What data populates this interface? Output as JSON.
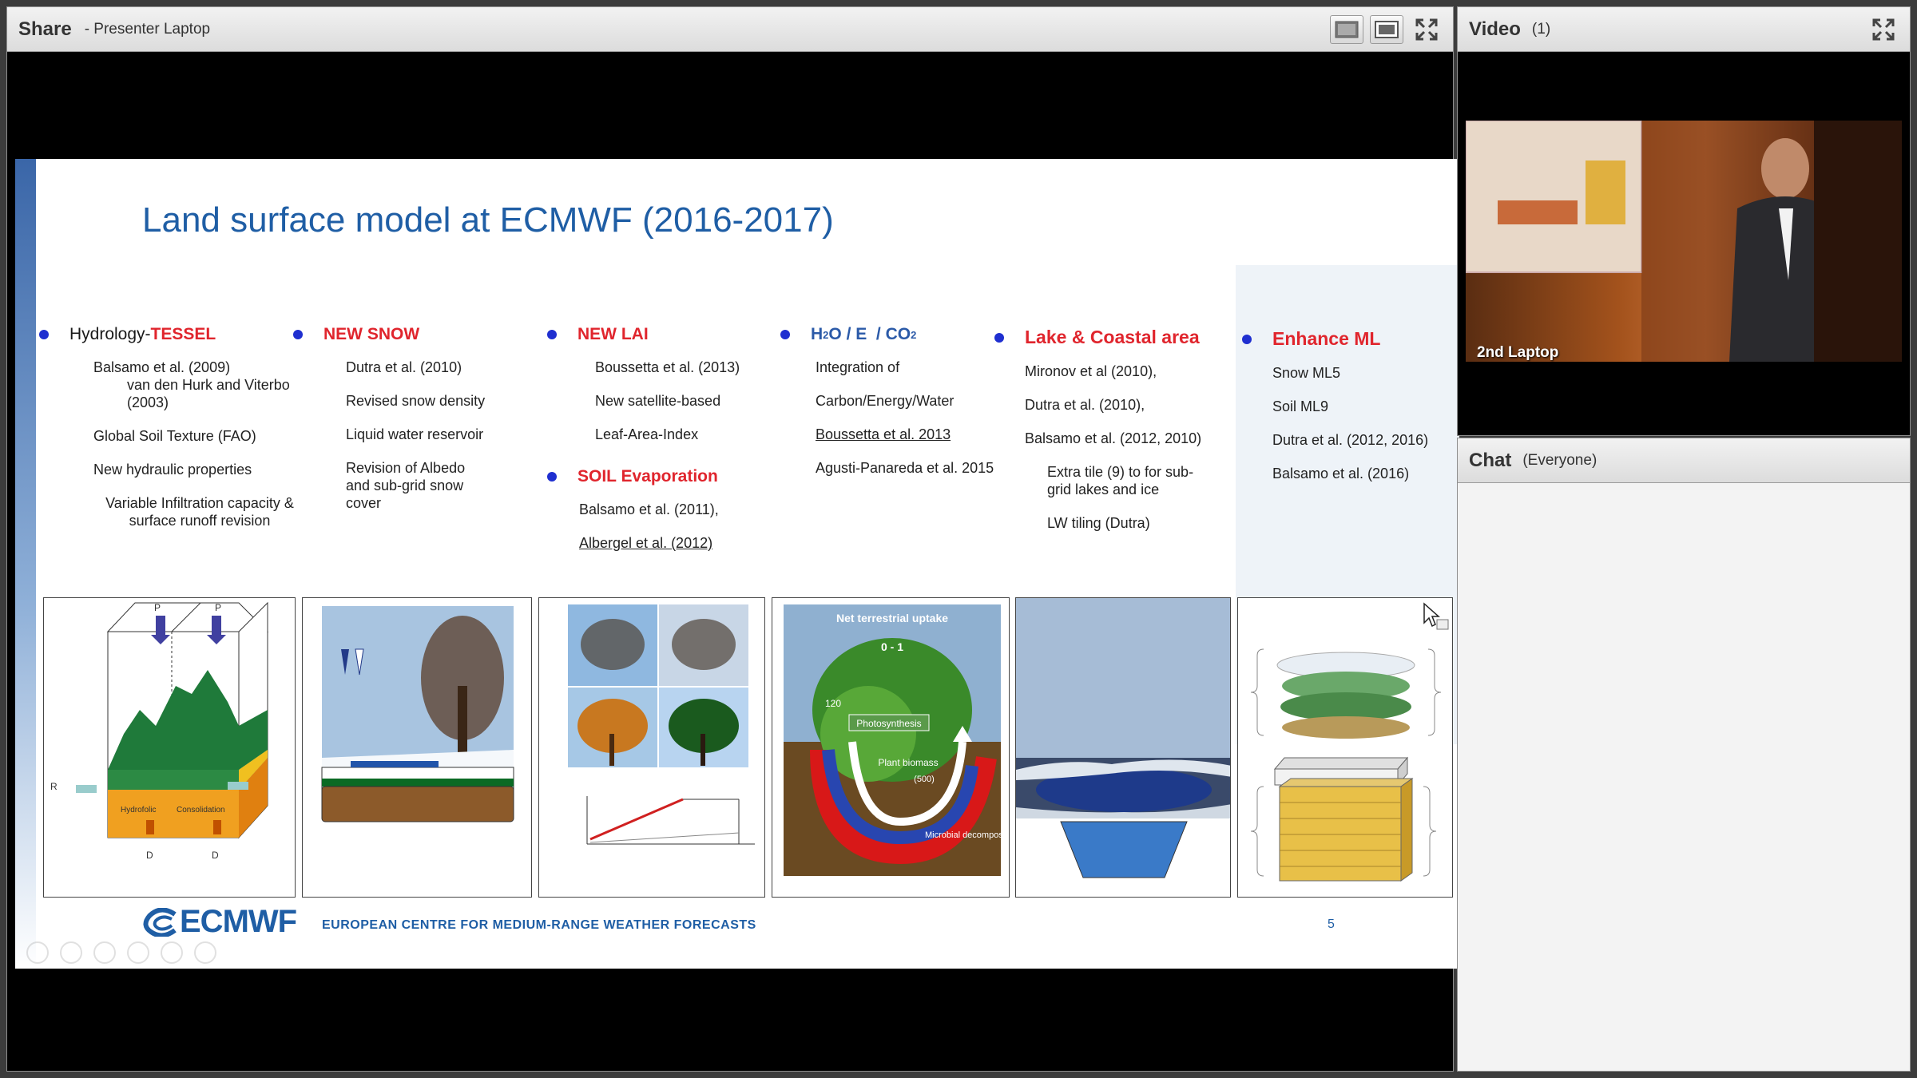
{
  "share_pod": {
    "title": "Share",
    "subtitle": "- Presenter Laptop"
  },
  "video_pod": {
    "title": "Video",
    "count": "(1)",
    "camera_label": "2nd Laptop"
  },
  "chat_pod": {
    "title": "Chat",
    "scope": "(Everyone)"
  },
  "slide": {
    "title": "Land surface model at ECMWF (2016-2017)",
    "page_number": "5",
    "footer_logo": "ECMWF",
    "footer_text": "EUROPEAN CENTRE FOR MEDIUM-RANGE WEATHER FORECASTS",
    "columns": [
      {
        "head_black": "Hydrology-",
        "head_red": "TESSEL",
        "items": [
          "Balsamo et al. (2009)",
          "van den Hurk and Viterbo (2003)",
          "Global Soil Texture (FAO)",
          "New hydraulic properties",
          "Variable Infiltration capacity & surface runoff revision"
        ]
      },
      {
        "head": "NEW SNOW",
        "items": [
          "Dutra et al. (2010)",
          "Revised snow density",
          "Liquid water reservoir",
          "Revision of Albedo and sub-grid snow cover"
        ]
      },
      {
        "head": "NEW LAI",
        "items": [
          "Boussetta et al. (2013)",
          "New satellite-based",
          "Leaf-Area-Index"
        ],
        "head2": "SOIL Evaporation",
        "items2": [
          "Balsamo et al. (2011),",
          "Albergel et al. (2012)"
        ]
      },
      {
        "head_h": "H",
        "head_sub1": "2",
        "head_o": "O / E  / CO",
        "head_sub2": "2",
        "items": [
          "Integration of",
          "Carbon/Energy/Water",
          "Boussetta et al. 2013",
          "Agusti-Panareda et al. 2015"
        ]
      },
      {
        "head": "Lake & Coastal area",
        "items": [
          "Mironov et al (2010),",
          "Dutra et al. (2010),",
          "Balsamo et al. (2012, 2010)",
          "Extra tile (9) to for sub-grid lakes and ice",
          "LW tiling (Dutra)"
        ]
      },
      {
        "head": "Enhance ML",
        "items": [
          "Snow ML5",
          "Soil ML9",
          "Dutra et al. (2012, 2016)",
          "Balsamo et al. (2016)"
        ]
      }
    ],
    "figure_labels": {
      "tessel_p1": "P",
      "tessel_p2": "P",
      "tessel_r": "R",
      "tessel_d1": "D",
      "tessel_d2": "D",
      "tessel_hydrofoil": "Hydrofolic",
      "tessel_consolidation": "Consolidation",
      "carbon_net": "Net terrestrial uptake",
      "carbon_net2": "0 - 1",
      "carbon_photo": "Photosynthesis",
      "carbon_biomass": "Plant biomass",
      "carbon_500": "(500)",
      "carbon_120": "120",
      "carbon_micro": "Microbial decomposition"
    }
  }
}
